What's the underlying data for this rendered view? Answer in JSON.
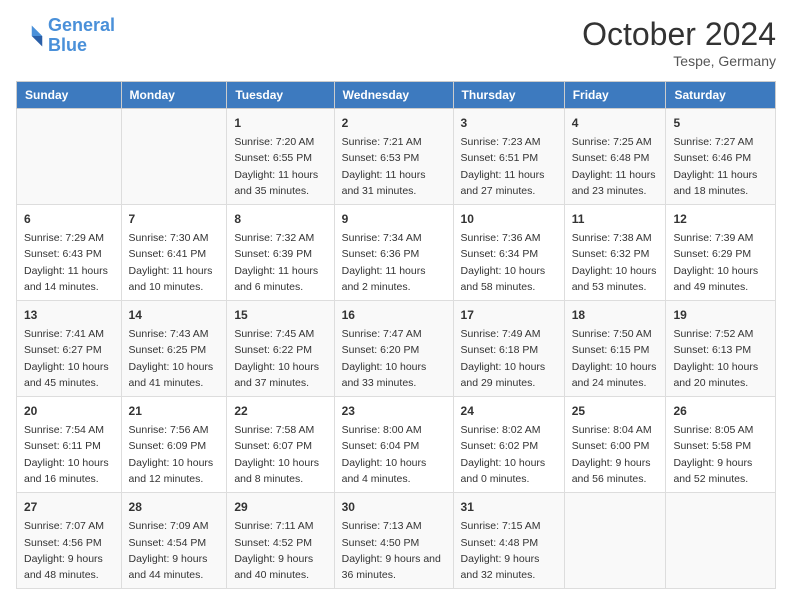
{
  "header": {
    "logo_line1": "General",
    "logo_line2": "Blue",
    "month": "October 2024",
    "location": "Tespe, Germany"
  },
  "weekdays": [
    "Sunday",
    "Monday",
    "Tuesday",
    "Wednesday",
    "Thursday",
    "Friday",
    "Saturday"
  ],
  "weeks": [
    [
      {
        "day": "",
        "sunrise": "",
        "sunset": "",
        "daylight": ""
      },
      {
        "day": "",
        "sunrise": "",
        "sunset": "",
        "daylight": ""
      },
      {
        "day": "1",
        "sunrise": "Sunrise: 7:20 AM",
        "sunset": "Sunset: 6:55 PM",
        "daylight": "Daylight: 11 hours and 35 minutes."
      },
      {
        "day": "2",
        "sunrise": "Sunrise: 7:21 AM",
        "sunset": "Sunset: 6:53 PM",
        "daylight": "Daylight: 11 hours and 31 minutes."
      },
      {
        "day": "3",
        "sunrise": "Sunrise: 7:23 AM",
        "sunset": "Sunset: 6:51 PM",
        "daylight": "Daylight: 11 hours and 27 minutes."
      },
      {
        "day": "4",
        "sunrise": "Sunrise: 7:25 AM",
        "sunset": "Sunset: 6:48 PM",
        "daylight": "Daylight: 11 hours and 23 minutes."
      },
      {
        "day": "5",
        "sunrise": "Sunrise: 7:27 AM",
        "sunset": "Sunset: 6:46 PM",
        "daylight": "Daylight: 11 hours and 18 minutes."
      }
    ],
    [
      {
        "day": "6",
        "sunrise": "Sunrise: 7:29 AM",
        "sunset": "Sunset: 6:43 PM",
        "daylight": "Daylight: 11 hours and 14 minutes."
      },
      {
        "day": "7",
        "sunrise": "Sunrise: 7:30 AM",
        "sunset": "Sunset: 6:41 PM",
        "daylight": "Daylight: 11 hours and 10 minutes."
      },
      {
        "day": "8",
        "sunrise": "Sunrise: 7:32 AM",
        "sunset": "Sunset: 6:39 PM",
        "daylight": "Daylight: 11 hours and 6 minutes."
      },
      {
        "day": "9",
        "sunrise": "Sunrise: 7:34 AM",
        "sunset": "Sunset: 6:36 PM",
        "daylight": "Daylight: 11 hours and 2 minutes."
      },
      {
        "day": "10",
        "sunrise": "Sunrise: 7:36 AM",
        "sunset": "Sunset: 6:34 PM",
        "daylight": "Daylight: 10 hours and 58 minutes."
      },
      {
        "day": "11",
        "sunrise": "Sunrise: 7:38 AM",
        "sunset": "Sunset: 6:32 PM",
        "daylight": "Daylight: 10 hours and 53 minutes."
      },
      {
        "day": "12",
        "sunrise": "Sunrise: 7:39 AM",
        "sunset": "Sunset: 6:29 PM",
        "daylight": "Daylight: 10 hours and 49 minutes."
      }
    ],
    [
      {
        "day": "13",
        "sunrise": "Sunrise: 7:41 AM",
        "sunset": "Sunset: 6:27 PM",
        "daylight": "Daylight: 10 hours and 45 minutes."
      },
      {
        "day": "14",
        "sunrise": "Sunrise: 7:43 AM",
        "sunset": "Sunset: 6:25 PM",
        "daylight": "Daylight: 10 hours and 41 minutes."
      },
      {
        "day": "15",
        "sunrise": "Sunrise: 7:45 AM",
        "sunset": "Sunset: 6:22 PM",
        "daylight": "Daylight: 10 hours and 37 minutes."
      },
      {
        "day": "16",
        "sunrise": "Sunrise: 7:47 AM",
        "sunset": "Sunset: 6:20 PM",
        "daylight": "Daylight: 10 hours and 33 minutes."
      },
      {
        "day": "17",
        "sunrise": "Sunrise: 7:49 AM",
        "sunset": "Sunset: 6:18 PM",
        "daylight": "Daylight: 10 hours and 29 minutes."
      },
      {
        "day": "18",
        "sunrise": "Sunrise: 7:50 AM",
        "sunset": "Sunset: 6:15 PM",
        "daylight": "Daylight: 10 hours and 24 minutes."
      },
      {
        "day": "19",
        "sunrise": "Sunrise: 7:52 AM",
        "sunset": "Sunset: 6:13 PM",
        "daylight": "Daylight: 10 hours and 20 minutes."
      }
    ],
    [
      {
        "day": "20",
        "sunrise": "Sunrise: 7:54 AM",
        "sunset": "Sunset: 6:11 PM",
        "daylight": "Daylight: 10 hours and 16 minutes."
      },
      {
        "day": "21",
        "sunrise": "Sunrise: 7:56 AM",
        "sunset": "Sunset: 6:09 PM",
        "daylight": "Daylight: 10 hours and 12 minutes."
      },
      {
        "day": "22",
        "sunrise": "Sunrise: 7:58 AM",
        "sunset": "Sunset: 6:07 PM",
        "daylight": "Daylight: 10 hours and 8 minutes."
      },
      {
        "day": "23",
        "sunrise": "Sunrise: 8:00 AM",
        "sunset": "Sunset: 6:04 PM",
        "daylight": "Daylight: 10 hours and 4 minutes."
      },
      {
        "day": "24",
        "sunrise": "Sunrise: 8:02 AM",
        "sunset": "Sunset: 6:02 PM",
        "daylight": "Daylight: 10 hours and 0 minutes."
      },
      {
        "day": "25",
        "sunrise": "Sunrise: 8:04 AM",
        "sunset": "Sunset: 6:00 PM",
        "daylight": "Daylight: 9 hours and 56 minutes."
      },
      {
        "day": "26",
        "sunrise": "Sunrise: 8:05 AM",
        "sunset": "Sunset: 5:58 PM",
        "daylight": "Daylight: 9 hours and 52 minutes."
      }
    ],
    [
      {
        "day": "27",
        "sunrise": "Sunrise: 7:07 AM",
        "sunset": "Sunset: 4:56 PM",
        "daylight": "Daylight: 9 hours and 48 minutes."
      },
      {
        "day": "28",
        "sunrise": "Sunrise: 7:09 AM",
        "sunset": "Sunset: 4:54 PM",
        "daylight": "Daylight: 9 hours and 44 minutes."
      },
      {
        "day": "29",
        "sunrise": "Sunrise: 7:11 AM",
        "sunset": "Sunset: 4:52 PM",
        "daylight": "Daylight: 9 hours and 40 minutes."
      },
      {
        "day": "30",
        "sunrise": "Sunrise: 7:13 AM",
        "sunset": "Sunset: 4:50 PM",
        "daylight": "Daylight: 9 hours and 36 minutes."
      },
      {
        "day": "31",
        "sunrise": "Sunrise: 7:15 AM",
        "sunset": "Sunset: 4:48 PM",
        "daylight": "Daylight: 9 hours and 32 minutes."
      },
      {
        "day": "",
        "sunrise": "",
        "sunset": "",
        "daylight": ""
      },
      {
        "day": "",
        "sunrise": "",
        "sunset": "",
        "daylight": ""
      }
    ]
  ]
}
